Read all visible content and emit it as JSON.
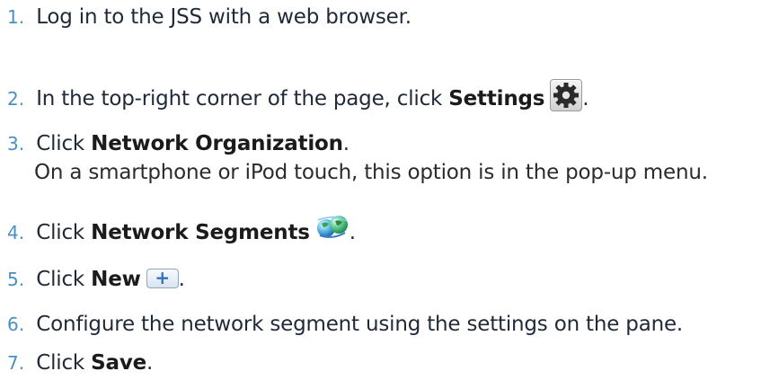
{
  "steps": [
    {
      "number": "1.",
      "text": "Log in to the JSS with a web browser."
    },
    {
      "number": "2.",
      "before": "In the top-right corner of the page, click",
      "bold": "Settings",
      "after": "."
    },
    {
      "number": "3.",
      "before": "Click",
      "bold": "Network Organization",
      "after": ".",
      "subtext": "On a smartphone or iPod touch, this option is in the pop-up menu."
    },
    {
      "number": "4.",
      "before": "Click",
      "bold": "Network Segments",
      "after": "."
    },
    {
      "number": "5.",
      "before": "Click",
      "bold": "New",
      "after": "."
    },
    {
      "number": "6.",
      "text": "Configure the network segment using the settings on the pane."
    },
    {
      "number": "7.",
      "before": "Click",
      "bold": "Save",
      "after": "."
    }
  ],
  "icons": {
    "settings": "gear-icon",
    "network_segments": "globe-network-icon",
    "new": "plus-icon"
  },
  "colors": {
    "step_number": "#4a90c2",
    "text": "#1f2937"
  }
}
